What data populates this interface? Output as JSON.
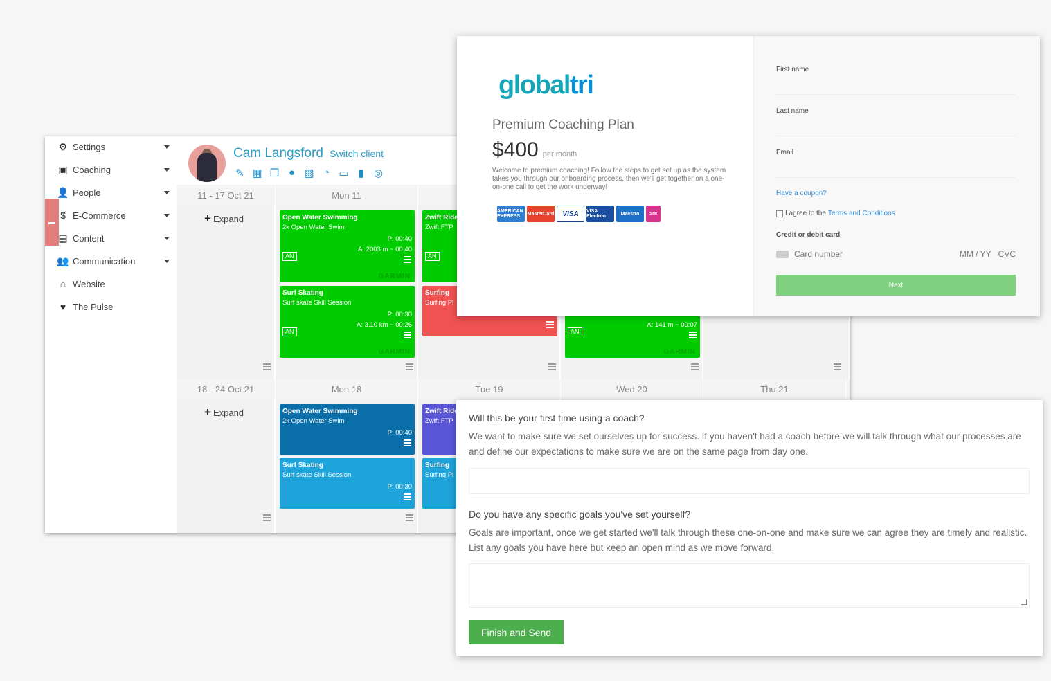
{
  "sidebar": {
    "items": [
      {
        "label": "Settings",
        "icon": "gears-icon",
        "glyph": "⚙",
        "has_caret": true
      },
      {
        "label": "Coaching",
        "icon": "coaching-board-icon",
        "glyph": "▣",
        "has_caret": true
      },
      {
        "label": "People",
        "icon": "user-icon",
        "glyph": "👤",
        "has_caret": true
      },
      {
        "label": "E-Commerce",
        "icon": "dollar-icon",
        "glyph": "$",
        "has_caret": true
      },
      {
        "label": "Content",
        "icon": "newspaper-icon",
        "glyph": "▤",
        "has_caret": true
      },
      {
        "label": "Communication",
        "icon": "users-icon",
        "glyph": "👥",
        "has_caret": true
      },
      {
        "label": "Website",
        "icon": "home-icon",
        "glyph": "⌂",
        "has_caret": false
      },
      {
        "label": "The Pulse",
        "icon": "heartbeat-icon",
        "glyph": "♥",
        "has_caret": false
      }
    ]
  },
  "client": {
    "name": "Cam Langsford",
    "switch_label": "Switch client",
    "tool_icons": [
      {
        "name": "edit-icon",
        "glyph": "✎"
      },
      {
        "name": "calendar-icon",
        "glyph": "▦"
      },
      {
        "name": "copy-icon",
        "glyph": "❐"
      },
      {
        "name": "user-icon",
        "glyph": "●"
      },
      {
        "name": "image-icon",
        "glyph": "▨"
      },
      {
        "name": "dashboard-icon",
        "glyph": "◔"
      },
      {
        "name": "money-icon",
        "glyph": "▭"
      },
      {
        "name": "file-icon",
        "glyph": "▮"
      },
      {
        "name": "target-icon",
        "glyph": "◎"
      }
    ]
  },
  "weeks": [
    {
      "range": "11 - 17 Oct 21",
      "expand": "Expand",
      "days": [
        "Mon 11"
      ]
    },
    {
      "range": "18 - 24 Oct 21",
      "expand": "Expand",
      "days": [
        "Mon 18",
        "Tue 19",
        "Wed 20",
        "Thu 21"
      ]
    }
  ],
  "workouts": {
    "w1_mon_swim": {
      "title": "Open Water Swimming",
      "sub": "2k Open Water Swim",
      "planned": "P: 00:40",
      "actual": "A: 2003 m ~ 00:40",
      "badge": "AN",
      "brand": "GARMIN"
    },
    "w1_mon_skate": {
      "title": "Surf Skating",
      "sub": "Surf skate Skill Session",
      "planned": "P: 00:30",
      "actual": "A: 3.10 km ~ 00:26",
      "badge": "AN",
      "brand": "GARMIN"
    },
    "w1_tue_ride": {
      "title": "Zwift Ride",
      "sub": "Zwift FTP",
      "badge": "AN"
    },
    "w1_tue_surf": {
      "title": "Surfing",
      "sub": "Surfing Pl"
    },
    "w1_wed": {
      "actual": "A: 141 m ~ 00:07",
      "badge": "AN",
      "brand": "GARMIN"
    },
    "w2_mon_swim": {
      "title": "Open Water Swimming",
      "sub": "2k Open Water Swim",
      "planned": "P: 00:40"
    },
    "w2_mon_skate": {
      "title": "Surf Skating",
      "sub": "Surf skate Skill Session",
      "planned": "P: 00:30"
    },
    "w2_tue_ride": {
      "title": "Zwift Ride",
      "sub": "Zwift FTP"
    },
    "w2_tue_surf": {
      "title": "Surfing",
      "sub": "Surfing Pl"
    }
  },
  "payment": {
    "logo_a": "global",
    "logo_b": "tri",
    "plan": "Premium Coaching Plan",
    "price": "$400",
    "per": "per month",
    "welcome": "Welcome to premium coaching! Follow the steps to get set up as the system takes you through our onboarding process, then we'll get together on a one-on-one call to get the work underway!",
    "card_logos": [
      "AMERICAN EXPRESS",
      "MasterCard",
      "VISA",
      "VISA Electron",
      "Maestro",
      "Solo"
    ],
    "first_name_label": "First name",
    "last_name_label": "Last name",
    "email_label": "Email",
    "coupon": "Have a coupon?",
    "agree_prefix": "I agree to the",
    "agree_link": "Terms and Conditions",
    "card_label": "Credit or debit card",
    "card_number_placeholder": "Card number",
    "card_expiry_placeholder": "MM / YY",
    "card_cvc_placeholder": "CVC",
    "next": "Next",
    "colors": {
      "accent_green": "#7fd17f",
      "logo_teal": "#16a6b8",
      "logo_blue": "#0a8fd3"
    }
  },
  "questions": {
    "q1_title": "Will this be your first time using a coach?",
    "q1_text": "We want to make sure we set ourselves up for success. If you haven't had a coach before we will talk through what our processes are and define our expectations to make sure we are on the same page from day one.",
    "q1_value": "",
    "q2_title": "Do you have any specific goals you've set yourself?",
    "q2_text": "Goals are important, once we get started we'll talk through these one-on-one and make sure we can agree they are timely and realistic. List any goals you have here but keep an open mind as we move forward.",
    "q2_value": "",
    "submit": "Finish and Send"
  }
}
